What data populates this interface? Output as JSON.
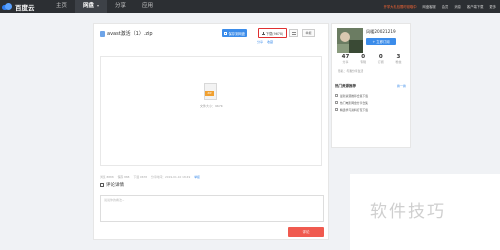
{
  "topbar": {
    "logo_text": "百度云",
    "nav": [
      {
        "label": "主页"
      },
      {
        "label": "网盘"
      },
      {
        "label": "分享"
      },
      {
        "label": "应用"
      }
    ],
    "links": {
      "promo": "开学大礼包限时领取中",
      "l1": "网盘客服",
      "l2": "会员",
      "l3": "消息",
      "l4": "客户端下载",
      "l5": "更多"
    }
  },
  "file": {
    "name": "avast激活（1）.zip",
    "save_label": "保存到网盘",
    "download_label": "下载(9678)",
    "report_label": "举报",
    "share_text": "分享",
    "fav_text": "收藏",
    "zip_tag": "ZIP",
    "size_text": "文件大小：967K",
    "meta": {
      "views": "浏览 8888",
      "saves": "保存 888",
      "downloads": "下载 9678",
      "date": "分享时间：2019-01-10 18:49",
      "report_link": "举报"
    }
  },
  "comments": {
    "title": "评论详情",
    "placeholder": "说说你的看法~",
    "submit_label": "评论"
  },
  "user": {
    "name": "风暖20021219",
    "follow_label": "+ 立即订阅",
    "stats": [
      {
        "num": "47",
        "label": "分享"
      },
      {
        "num": "0",
        "label": "专辑"
      },
      {
        "num": "0",
        "label": "订阅"
      },
      {
        "num": "3",
        "label": "粉丝"
      }
    ],
    "bio": "签名：与我分享生活"
  },
  "hot": {
    "title": "热门资源推荐",
    "more": "换一换",
    "items": [
      {
        "label": "最新资源推荐合集下载"
      },
      {
        "label": "热门电影网盘分享合集"
      },
      {
        "label": "精选学习资料打包下载"
      }
    ]
  },
  "watermark": "软件技巧",
  "colors": {
    "topbar": "#2c2f33",
    "accent_blue": "#3b8cea",
    "download_border": "#e03030",
    "comment_button": "#f05a4f",
    "zip_tag": "#f0a030"
  }
}
